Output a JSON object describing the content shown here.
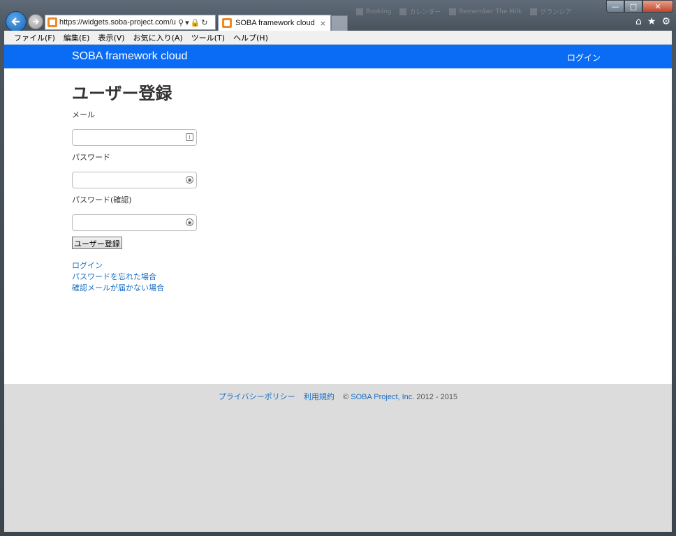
{
  "browser": {
    "url": "https://widgets.soba-project.com/u",
    "tab_title": "SOBA framework cloud",
    "tab_close": "×",
    "faded_favorites": [
      "Booking",
      "カレンダー",
      "Remember The Milk",
      "グランシア"
    ]
  },
  "menubar": {
    "items": [
      "ファイル(F)",
      "編集(E)",
      "表示(V)",
      "お気に入り(A)",
      "ツール(T)",
      "ヘルプ(H)"
    ]
  },
  "navbar": {
    "brand": "SOBA framework cloud",
    "login": "ログイン"
  },
  "form": {
    "title": "ユーザー登録",
    "email_label": "メール",
    "password_label": "パスワード",
    "password_confirm_label": "パスワード(確認)",
    "submit_label": "ユーザー登録"
  },
  "links": {
    "login": "ログイン",
    "forgot_password": "パスワードを忘れた場合",
    "no_confirmation_mail": "確認メールが届かない場合"
  },
  "footer": {
    "privacy": "プライバシーポリシー",
    "terms": "利用規約",
    "copyright_symbol": "©",
    "company": "SOBA Project, Inc.",
    "years": "2012 - 2015"
  },
  "colors": {
    "navbar": "#0a6cf5",
    "link": "#1a6fc4",
    "footer_bg": "#dcdcdc"
  }
}
